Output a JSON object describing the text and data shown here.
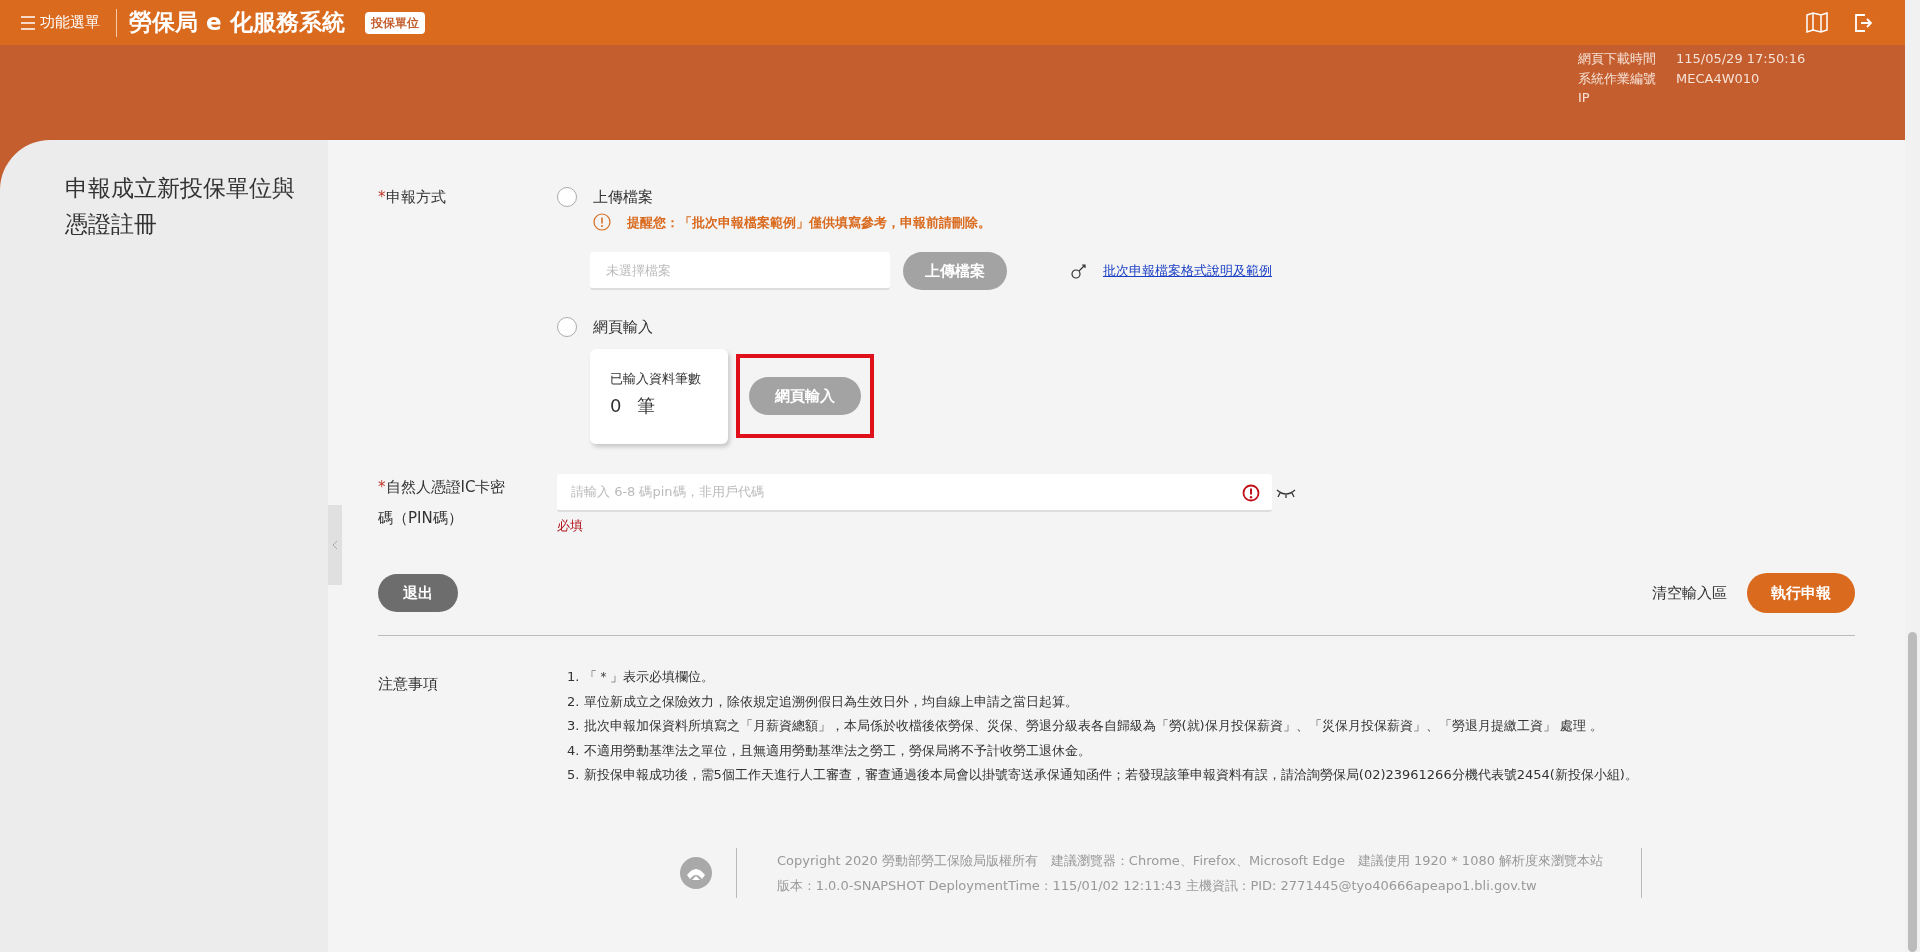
{
  "header": {
    "menu_label": "功能選單",
    "title": "勞保局 e 化服務系統",
    "badge": "投保單位"
  },
  "page_info": [
    {
      "label": "網頁下載時間",
      "value": "115/05/29 17:50:16"
    },
    {
      "label": "系統作業編號",
      "value": "MECA4W010"
    },
    {
      "label": "IP"
    }
  ],
  "sidebar": {
    "title": "申報成立新投保單位與憑證註冊"
  },
  "form": {
    "method": {
      "required_mark": "*",
      "label": "申報方式",
      "options": [
        {
          "kind": "upload",
          "label": "上傳檔案",
          "selected": false,
          "notice": "提醒您：「批次申報檔案範例」僅供填寫參考，申報前請刪除。",
          "file_placeholder": "未選擇檔案",
          "button": "上傳檔案",
          "disabled": true,
          "link": "批次申報檔案格式說明及範例"
        },
        {
          "kind": "web",
          "label": "網頁輸入",
          "selected": false,
          "count_label": "已輸入資料筆數",
          "count": "0",
          "unit": "筆",
          "button": "網頁輸入",
          "disabled": true,
          "highlighted": true
        }
      ]
    },
    "pin": {
      "required_mark": "*",
      "label": "自然人憑證IC卡密碼（PIN碼）",
      "placeholder": "請輸入 6-8 碼pin碼，非用戶代碼",
      "error": "必填"
    }
  },
  "actions": {
    "exit": "退出",
    "clear": "清空輸入區",
    "submit": "執行申報"
  },
  "notes": {
    "title": "注意事項",
    "items": [
      "1. 「＊」表示必填欄位。",
      "2. 單位新成立之保險效力，除依規定追溯例假日為生效日外，均自線上申請之當日起算。",
      "3. 批次申報加保資料所填寫之「月薪資總額」，本局係於收檔後依勞保、災保、勞退分級表各自歸級為「勞(就)保月投保薪資」、「災保月投保薪資」、「勞退月提繳工資」 處理 。",
      "4. 不適用勞動基準法之單位，且無適用勞動基準法之勞工，勞保局將不予計收勞工退休金。",
      "5. 新投保申報成功後，需5個工作天進行人工審查，審查通過後本局會以掛號寄送承保通知函件；若發現該筆申報資料有誤，請洽詢勞保局(02)23961266分機代表號2454(新投保小組)。"
    ]
  },
  "footer": {
    "lines": [
      "Copyright 2020 勞動部勞工保險局版權所有　建議瀏覽器：Chrome、Firefox、Microsoft Edge　建議使用 1920 * 1080 解析度來瀏覽本站",
      "版本 : 1.0.0-SNAPSHOT DeploymentTime : 115/01/02 12:11:43 主機資訊 : PID: 2771445@tyo40666apeapo1.bli.gov.tw"
    ]
  }
}
